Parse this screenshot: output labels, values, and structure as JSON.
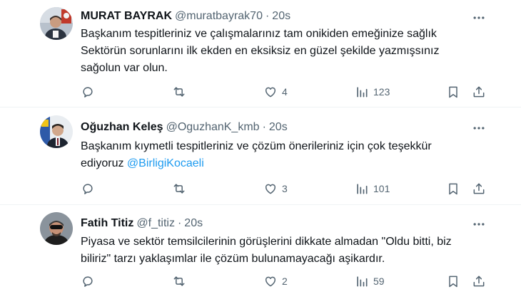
{
  "tweets": [
    {
      "name": "MURAT BAYRAK",
      "handle": "@muratbayrak70",
      "separator": "·",
      "time": "20s",
      "lines": [
        "Başkanım tespitleriniz ve çalışmalarınız  tam onikiden emeğinize sağlık",
        "Sektörün sorunlarını ilk ekden en eksiksiz en güzel şekilde yazmışsınız",
        "sağolun var olun."
      ],
      "likes": "4",
      "views": "123"
    },
    {
      "name": "Oğuzhan Keleş",
      "handle": "@OguzhanK_kmb",
      "separator": "·",
      "time": "20s",
      "lines": [
        "Başkanım kıymetli tespitleriniz ve çözüm önerileriniz için çok teşekkür"
      ],
      "line2_prefix": "ediyoruz ",
      "mention": "@BirligiKocaeli",
      "likes": "3",
      "views": "101"
    },
    {
      "name": "Fatih Titiz",
      "handle": "@f_titiz",
      "separator": "·",
      "time": "20s",
      "lines": [
        "Piyasa ve sektör temsilcilerinin görüşlerini dikkate almadan \"Oldu bitti, biz",
        "biliriz\" tarzı yaklaşımlar ile çözüm bulunamayacağı aşikardır."
      ],
      "likes": "2",
      "views": "59"
    }
  ],
  "icons": {
    "more": "more-dots-icon",
    "reply": "reply-icon",
    "retweet": "retweet-icon",
    "like": "heart-icon",
    "views": "views-icon",
    "bookmark": "bookmark-icon",
    "share": "share-icon"
  },
  "colors": {
    "text": "#0f1419",
    "secondary": "#536471",
    "link": "#1d9bf0",
    "divider": "#eff3f4"
  }
}
